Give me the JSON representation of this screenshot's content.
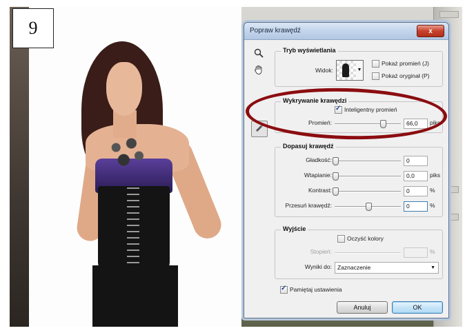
{
  "step_number": "9",
  "dialog": {
    "title": "Popraw krawędź",
    "close_label": "x",
    "view_mode": {
      "legend": "Tryb wyświetlania",
      "view_label": "Widok:",
      "show_radius_label": "Pokaż promień (J)",
      "show_radius_checked": false,
      "show_original_label": "Pokaż oryginał (P)",
      "show_original_checked": false
    },
    "edge_detection": {
      "legend": "Wykrywanie krawędzi",
      "smart_radius_label": "Inteligentny promień",
      "smart_radius_checked": true,
      "radius_label": "Promień:",
      "radius_value": "66,0",
      "radius_unit": "piks",
      "radius_fraction": 0.72
    },
    "adjust_edge": {
      "legend": "Dopasuj krawędź",
      "smooth_label": "Gładkość:",
      "smooth_value": "0",
      "smooth_fraction": 0.0,
      "feather_label": "Wtapianie:",
      "feather_value": "0,0",
      "feather_unit": "piks",
      "feather_fraction": 0.0,
      "contrast_label": "Kontrast:",
      "contrast_value": "0",
      "contrast_unit": "%",
      "contrast_fraction": 0.0,
      "shift_label": "Przesuń krawędź:",
      "shift_value": "0",
      "shift_unit": "%",
      "shift_fraction": 0.5
    },
    "output": {
      "legend": "Wyjście",
      "decontaminate_label": "Oczyść kolory",
      "decontaminate_checked": false,
      "amount_label": "Stopień:",
      "amount_value": "",
      "amount_unit": "%",
      "output_to_label": "Wyniki do:",
      "output_to_value": "Zaznaczenie"
    },
    "remember_label": "Pamiętaj ustawienia",
    "remember_checked": true,
    "cancel_label": "Anuluj",
    "ok_label": "OK"
  },
  "icons": {
    "zoom": "zoom-icon",
    "hand": "hand-icon",
    "refine_brush": "refine-radius-brush-icon"
  },
  "colors": {
    "annotation": "#8b0d10",
    "close_button": "#c7412c",
    "ok_border": "#3c7fb1"
  }
}
